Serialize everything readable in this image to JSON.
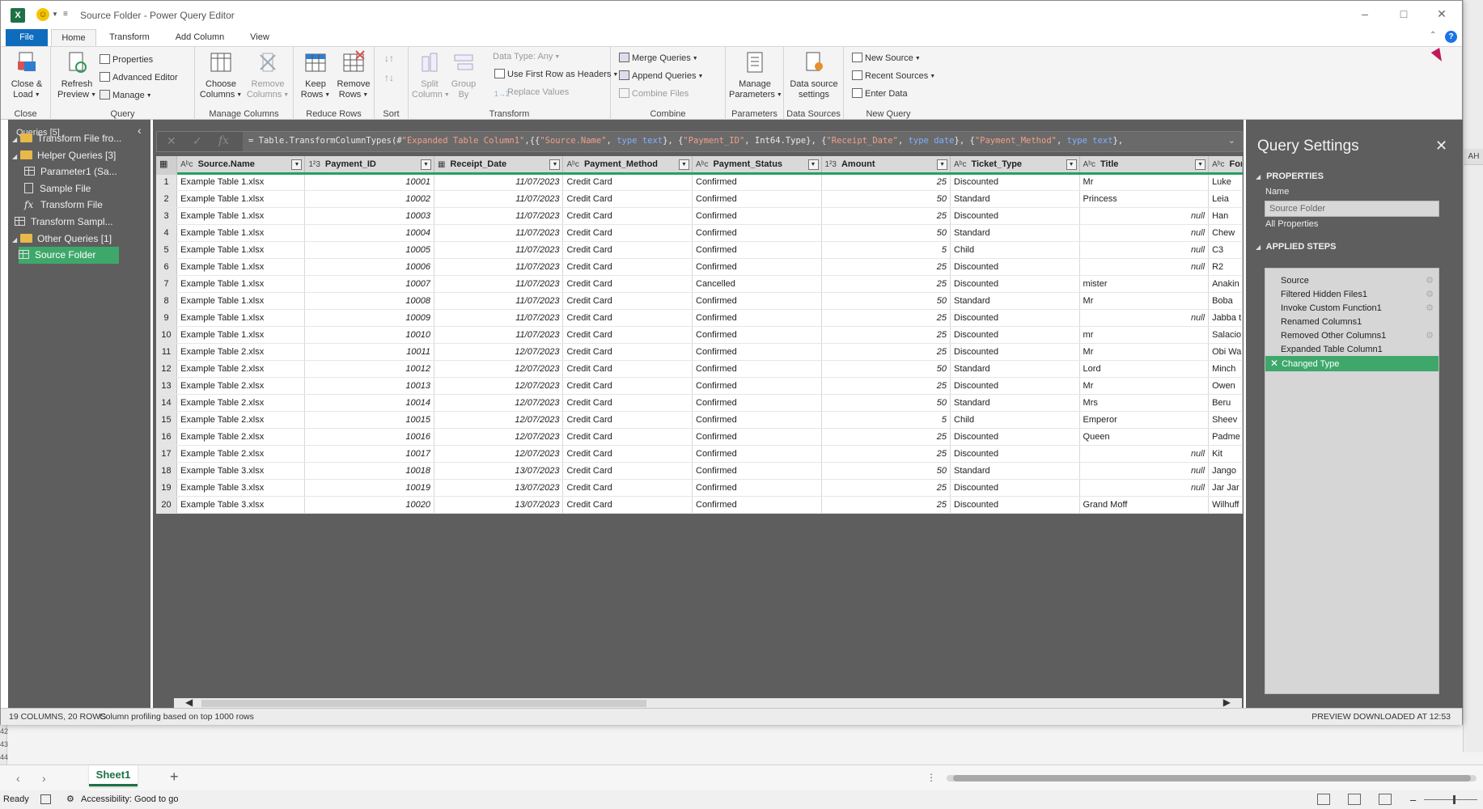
{
  "window": {
    "title": "Source Folder - Power Query Editor",
    "app_icon": "excel-icon"
  },
  "tabs": [
    "File",
    "Home",
    "Transform",
    "Add Column",
    "View"
  ],
  "ribbon": {
    "close": {
      "close_load": "Close &",
      "close_load2": "Load",
      "group": "Close"
    },
    "query": {
      "refresh": "Refresh",
      "refresh2": "Preview",
      "properties": "Properties",
      "advanced_editor": "Advanced Editor",
      "manage": "Manage",
      "group": "Query"
    },
    "manage_columns": {
      "choose": "Choose",
      "choose2": "Columns",
      "remove": "Remove",
      "remove2": "Columns",
      "group": "Manage Columns"
    },
    "reduce_rows": {
      "keep": "Keep",
      "keep2": "Rows",
      "remove": "Remove",
      "remove2": "Rows",
      "group": "Reduce Rows"
    },
    "sort": {
      "group": "Sort"
    },
    "transform": {
      "split": "Split",
      "split2": "Column",
      "group_by": "Group",
      "group_by2": "By",
      "data_type": "Data Type: Any",
      "first_row": "Use First Row as Headers",
      "replace": "Replace Values",
      "group": "Transform"
    },
    "combine": {
      "merge": "Merge Queries",
      "append": "Append Queries",
      "combine_files": "Combine Files",
      "group": "Combine"
    },
    "parameters": {
      "manage": "Manage",
      "manage2": "Parameters",
      "group": "Parameters"
    },
    "data_sources": {
      "settings": "Data source",
      "settings2": "settings",
      "group": "Data Sources"
    },
    "new_query": {
      "new_source": "New Source",
      "recent_sources": "Recent Sources",
      "enter_data": "Enter Data",
      "group": "New Query"
    }
  },
  "queries_pane": {
    "header": "Queries [5]",
    "items": [
      {
        "label": "Transform File fro...",
        "kind": "folder",
        "indent": 0
      },
      {
        "label": "Helper Queries [3]",
        "kind": "folder",
        "indent": 1
      },
      {
        "label": "Parameter1 (Sa...",
        "kind": "param",
        "indent": 2
      },
      {
        "label": "Sample File",
        "kind": "doc",
        "indent": 2
      },
      {
        "label": "Transform File",
        "kind": "fx",
        "indent": 2
      },
      {
        "label": "Transform Sampl...",
        "kind": "table",
        "indent": 1
      },
      {
        "label": "Other Queries [1]",
        "kind": "folder",
        "indent": 0
      },
      {
        "label": "Source Folder",
        "kind": "table",
        "indent": 1,
        "selected": true
      }
    ]
  },
  "formula_bar": {
    "text": "= Table.TransformColumnTypes(#\"Expanded Table Column1\",{{\"Source.Name\", type text}, {\"Payment_ID\", Int64.Type}, {\"Receipt_Date\", type date}, {\"Payment_Method\", type text},"
  },
  "grid": {
    "columns": [
      {
        "type": "ABC",
        "name": "Source.Name"
      },
      {
        "type": "123",
        "name": "Payment_ID"
      },
      {
        "type": "date",
        "name": "Receipt_Date"
      },
      {
        "type": "ABC",
        "name": "Payment_Method"
      },
      {
        "type": "ABC",
        "name": "Payment_Status"
      },
      {
        "type": "123",
        "name": "Amount"
      },
      {
        "type": "ABC",
        "name": "Ticket_Type"
      },
      {
        "type": "ABC",
        "name": "Title"
      },
      {
        "type": "ABC",
        "name": "For"
      }
    ],
    "rows": [
      [
        "Example Table 1.xlsx",
        "10001",
        "11/07/2023",
        "Credit Card",
        "Confirmed",
        "25",
        "Discounted",
        "Mr",
        "Luke"
      ],
      [
        "Example Table 1.xlsx",
        "10002",
        "11/07/2023",
        "Credit Card",
        "Confirmed",
        "50",
        "Standard",
        "Princess",
        "Leia"
      ],
      [
        "Example Table 1.xlsx",
        "10003",
        "11/07/2023",
        "Credit Card",
        "Confirmed",
        "25",
        "Discounted",
        "null",
        "Han"
      ],
      [
        "Example Table 1.xlsx",
        "10004",
        "11/07/2023",
        "Credit Card",
        "Confirmed",
        "50",
        "Standard",
        "null",
        "Chew"
      ],
      [
        "Example Table 1.xlsx",
        "10005",
        "11/07/2023",
        "Credit Card",
        "Confirmed",
        "5",
        "Child",
        "null",
        "C3"
      ],
      [
        "Example Table 1.xlsx",
        "10006",
        "11/07/2023",
        "Credit Card",
        "Confirmed",
        "25",
        "Discounted",
        "null",
        "R2"
      ],
      [
        "Example Table 1.xlsx",
        "10007",
        "11/07/2023",
        "Credit Card",
        "Cancelled",
        "25",
        "Discounted",
        "mister",
        "Anakin"
      ],
      [
        "Example Table 1.xlsx",
        "10008",
        "11/07/2023",
        "Credit Card",
        "Confirmed",
        "50",
        "Standard",
        "Mr",
        "Boba"
      ],
      [
        "Example Table 1.xlsx",
        "10009",
        "11/07/2023",
        "Credit Card",
        "Confirmed",
        "25",
        "Discounted",
        "null",
        "Jabba t"
      ],
      [
        "Example Table 1.xlsx",
        "10010",
        "11/07/2023",
        "Credit Card",
        "Confirmed",
        "25",
        "Discounted",
        "mr",
        "Salacio"
      ],
      [
        "Example Table 2.xlsx",
        "10011",
        "12/07/2023",
        "Credit Card",
        "Confirmed",
        "25",
        "Discounted",
        "Mr",
        "Obi Wa"
      ],
      [
        "Example Table 2.xlsx",
        "10012",
        "12/07/2023",
        "Credit Card",
        "Confirmed",
        "50",
        "Standard",
        "Lord",
        "Minch"
      ],
      [
        "Example Table 2.xlsx",
        "10013",
        "12/07/2023",
        "Credit Card",
        "Confirmed",
        "25",
        "Discounted",
        "Mr",
        "Owen"
      ],
      [
        "Example Table 2.xlsx",
        "10014",
        "12/07/2023",
        "Credit Card",
        "Confirmed",
        "50",
        "Standard",
        "Mrs",
        "Beru"
      ],
      [
        "Example Table 2.xlsx",
        "10015",
        "12/07/2023",
        "Credit Card",
        "Confirmed",
        "5",
        "Child",
        "Emperor",
        "Sheev"
      ],
      [
        "Example Table 2.xlsx",
        "10016",
        "12/07/2023",
        "Credit Card",
        "Confirmed",
        "25",
        "Discounted",
        "Queen",
        "Padme"
      ],
      [
        "Example Table 2.xlsx",
        "10017",
        "12/07/2023",
        "Credit Card",
        "Confirmed",
        "25",
        "Discounted",
        "null",
        "Kit"
      ],
      [
        "Example Table 3.xlsx",
        "10018",
        "13/07/2023",
        "Credit Card",
        "Confirmed",
        "50",
        "Standard",
        "null",
        "Jango"
      ],
      [
        "Example Table 3.xlsx",
        "10019",
        "13/07/2023",
        "Credit Card",
        "Confirmed",
        "25",
        "Discounted",
        "null",
        "Jar Jar"
      ],
      [
        "Example Table 3.xlsx",
        "10020",
        "13/07/2023",
        "Credit Card",
        "Confirmed",
        "25",
        "Discounted",
        "Grand Moff",
        "Wilhuff"
      ]
    ]
  },
  "settings": {
    "title": "Query Settings",
    "properties_header": "PROPERTIES",
    "name_label": "Name",
    "name_value": "Source Folder",
    "all_properties": "All Properties",
    "steps_header": "APPLIED STEPS",
    "steps": [
      {
        "label": "Source",
        "gear": true
      },
      {
        "label": "Filtered Hidden Files1",
        "gear": true
      },
      {
        "label": "Invoke Custom Function1",
        "gear": true
      },
      {
        "label": "Renamed Columns1",
        "gear": false
      },
      {
        "label": "Removed Other Columns1",
        "gear": true
      },
      {
        "label": "Expanded Table Column1",
        "gear": false
      },
      {
        "label": "Changed Type",
        "gear": false,
        "selected": true
      }
    ]
  },
  "status": {
    "left": "19 COLUMNS, 20 ROWS",
    "profiling": "Column profiling based on top 1000 rows",
    "right": "PREVIEW DOWNLOADED AT 12:53"
  },
  "excel": {
    "sheet": "Sheet1",
    "ready": "Ready",
    "accessibility": "Accessibility: Good to go",
    "col_header": "AH",
    "row_numbers": [
      "42",
      "43",
      "44"
    ]
  },
  "colors": {
    "accent_green": "#3ea86b",
    "file_tab": "#0f6cbd",
    "excel_green": "#1e7145"
  }
}
